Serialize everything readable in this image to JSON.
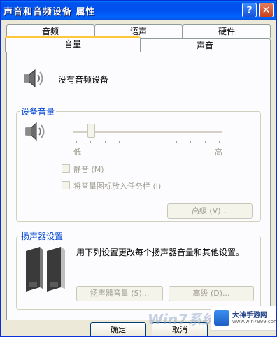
{
  "window": {
    "title": "声音和音频设备 属性",
    "help_label": "?",
    "close_label": "✕"
  },
  "tabs_back": [
    "音频",
    "语声",
    "硬件"
  ],
  "tabs_front": [
    "音量",
    "声音"
  ],
  "active_tab": "音量",
  "device": {
    "status_text": "没有音频设备",
    "icon": "speaker-icon"
  },
  "volume_group": {
    "label": "设备音量",
    "slider_min_label": "低",
    "slider_max_label": "高",
    "slider_value_fraction": 0.1,
    "mute_label": "静音 (M)",
    "taskbar_icon_label": "将音量图标放入任务栏 (I)",
    "advanced_label": "高级 (V)..."
  },
  "speaker_group": {
    "label": "扬声器设置",
    "description": "用下列设置更改每个扬声器音量和其他设置。",
    "speaker_volume_label": "扬声器音量 (S)...",
    "advanced_label": "高级 (D)..."
  },
  "footer": {
    "ok_label": "确定",
    "cancel_label": "取消"
  },
  "watermark": {
    "text": "Win7系统",
    "site": "大神手游网",
    "url": "www.win7999.com"
  },
  "colors": {
    "titlebar": "#0050ee",
    "window_bg": "#ece9d8",
    "group_label": "#0046d5",
    "active_tab_highlight": "#ffc83c"
  }
}
